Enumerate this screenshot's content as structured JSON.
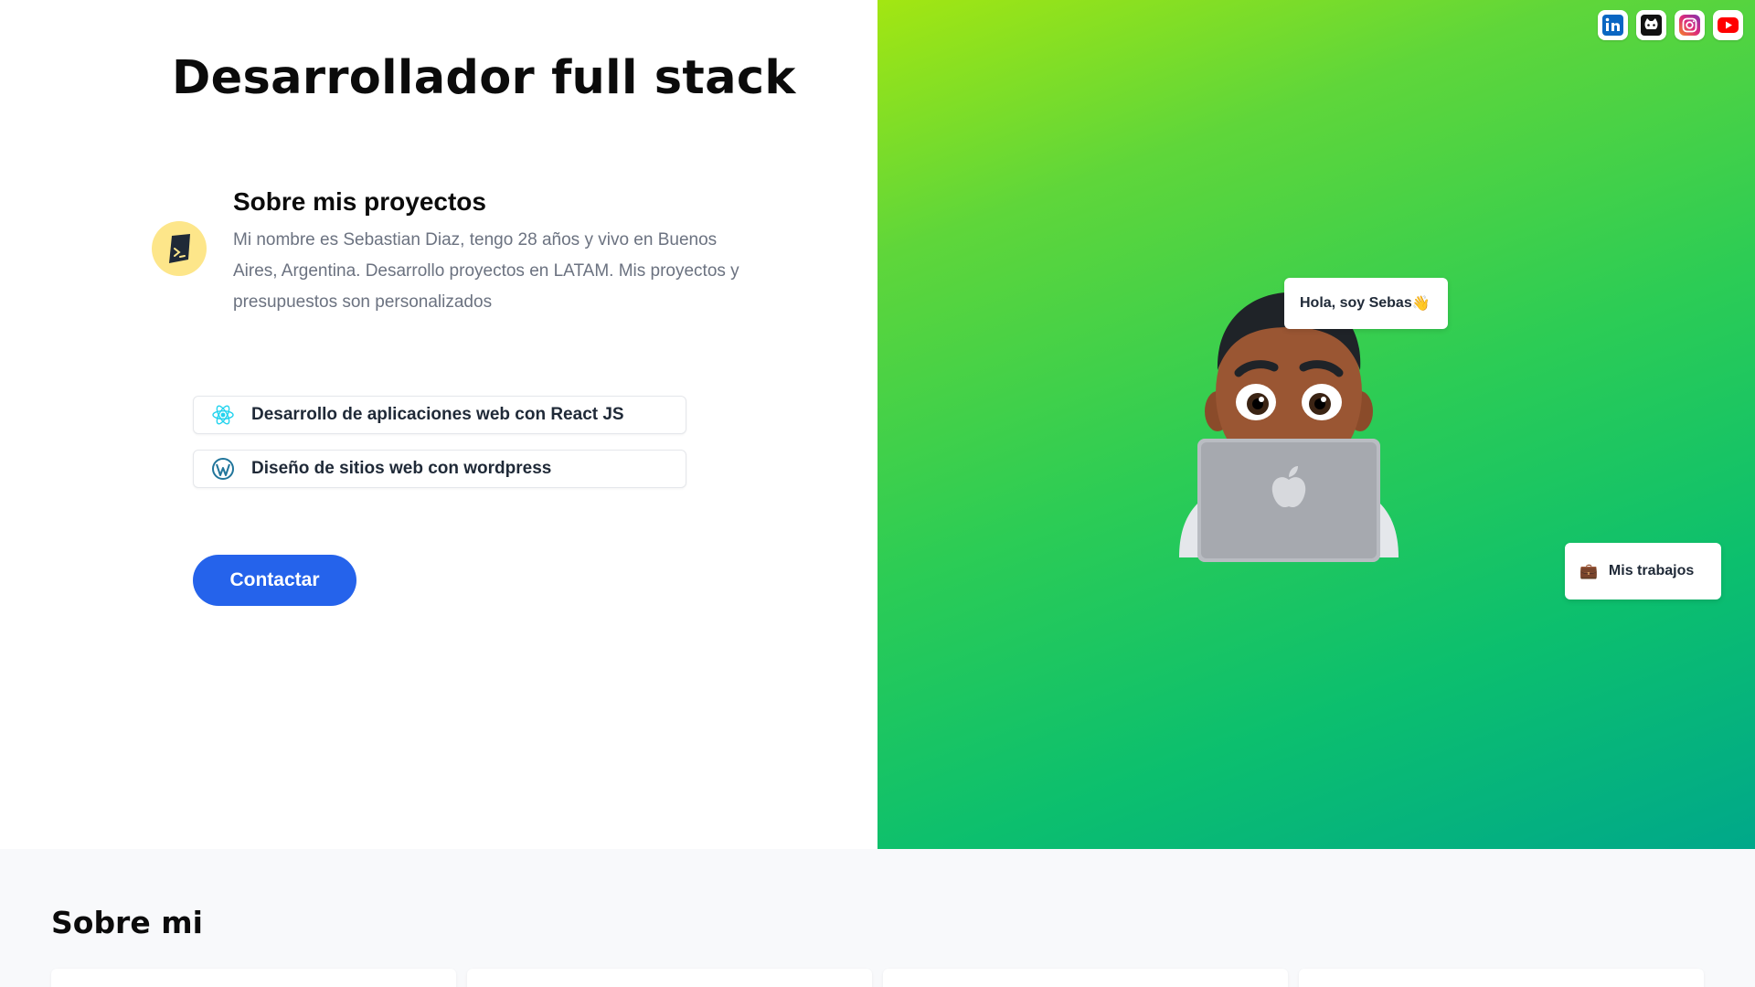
{
  "hero": {
    "title": "Desarrollador full stack",
    "about": {
      "title": "Sobre mis proyectos",
      "text": "Mi nombre es Sebastian Diaz, tengo 28 años y vivo en Buenos Aires, Argentina. Desarrollo proyectos en LATAM. Mis proyectos y presupuestos son personalizados",
      "icon": "terminal-icon"
    },
    "services": [
      {
        "label": "Desarrollo de aplicaciones web con React JS",
        "icon": "react-icon"
      },
      {
        "label": "Diseño de sitios web con wordpress",
        "icon": "wordpress-icon"
      }
    ],
    "contact_label": "Contactar"
  },
  "right_panel": {
    "socials": [
      {
        "name": "linkedin-icon",
        "color": "#0a66c2"
      },
      {
        "name": "github-icon",
        "color": "#111111"
      },
      {
        "name": "instagram-icon",
        "color": "#e1306c"
      },
      {
        "name": "youtube-icon",
        "color": "#ff0000"
      }
    ],
    "greeting": "Hola, soy Sebas",
    "greeting_emoji": "👋",
    "work_label": "Mis trabajos",
    "work_emoji": "💼",
    "gradient": [
      "#a3e612",
      "#00a88a"
    ]
  },
  "about_section": {
    "title": "Sobre mi"
  },
  "colors": {
    "primary": "#2563eb",
    "icon_bg": "#fde68a",
    "muted_text": "#6b7280"
  }
}
